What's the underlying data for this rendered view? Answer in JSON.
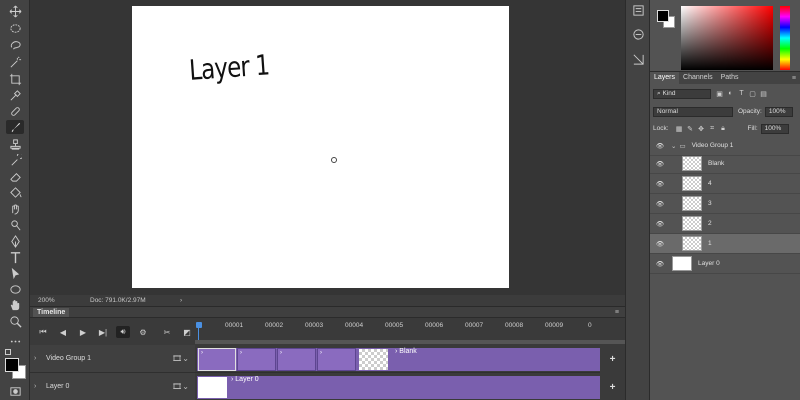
{
  "canvas": {
    "drawn_text": "Layer 1"
  },
  "status": {
    "zoom": "200%",
    "doc_info": "Doc: 791.0K/2.97M",
    "arrow": "›"
  },
  "timeline": {
    "title": "Timeline",
    "menu": "≡",
    "ruler_ticks": [
      "00001",
      "00002",
      "00003",
      "00004",
      "00005",
      "00006",
      "00007",
      "00008",
      "00009",
      "0"
    ],
    "tracks": [
      {
        "name": "Video Group 1",
        "clip_label": "Blank"
      },
      {
        "name": "Layer 0",
        "clip_label": "Layer 0"
      }
    ],
    "add_label": "+"
  },
  "layers_panel": {
    "tabs": [
      "Layers",
      "Channels",
      "Paths"
    ],
    "menu": "≡",
    "filter_label": "Kind",
    "blend_mode": "Normal",
    "opacity_label": "Opacity:",
    "opacity_value": "100%",
    "lock_label": "Lock:",
    "fill_label": "Fill:",
    "fill_value": "100%",
    "layers": [
      {
        "name": "Video Group 1",
        "type": "group",
        "selected": false
      },
      {
        "name": "Blank",
        "type": "transparent",
        "selected": false
      },
      {
        "name": "4",
        "type": "transparent",
        "selected": false
      },
      {
        "name": "3",
        "type": "transparent",
        "selected": false
      },
      {
        "name": "2",
        "type": "transparent",
        "selected": false
      },
      {
        "name": "1",
        "type": "transparent",
        "selected": true
      },
      {
        "name": "Layer 0",
        "type": "white",
        "selected": false
      }
    ]
  },
  "colors": {
    "accent_playhead": "#4a90e2",
    "clip_purple": "#7a5fae",
    "foreground": "#000000",
    "background": "#ffffff"
  }
}
